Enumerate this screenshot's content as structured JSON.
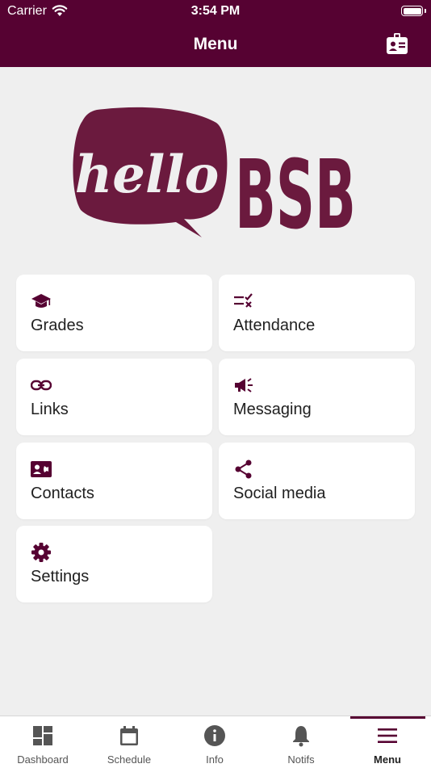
{
  "status_bar": {
    "carrier": "Carrier",
    "time": "3:54 PM"
  },
  "nav": {
    "title": "Menu",
    "right_icon": "id-badge-icon"
  },
  "logo": {
    "speech_text": "hello",
    "brand_text": "BSB",
    "color": "#6b1a3e"
  },
  "colors": {
    "primary": "#560232",
    "tile_bg": "#ffffff",
    "page_bg": "#efefef"
  },
  "menu_tiles": [
    {
      "label": "Grades",
      "icon": "graduation-cap-icon"
    },
    {
      "label": "Attendance",
      "icon": "checklist-icon"
    },
    {
      "label": "Links",
      "icon": "link-icon"
    },
    {
      "label": "Messaging",
      "icon": "megaphone-icon"
    },
    {
      "label": "Contacts",
      "icon": "contact-card-icon"
    },
    {
      "label": "Social media",
      "icon": "share-icon"
    },
    {
      "label": "Settings",
      "icon": "gear-icon"
    }
  ],
  "tab_bar": {
    "tabs": [
      {
        "label": "Dashboard",
        "icon": "dashboard-icon"
      },
      {
        "label": "Schedule",
        "icon": "calendar-icon"
      },
      {
        "label": "Info",
        "icon": "info-icon"
      },
      {
        "label": "Notifs",
        "icon": "bell-icon"
      },
      {
        "label": "Menu",
        "icon": "hamburger-menu-icon"
      }
    ],
    "active": "Menu"
  }
}
